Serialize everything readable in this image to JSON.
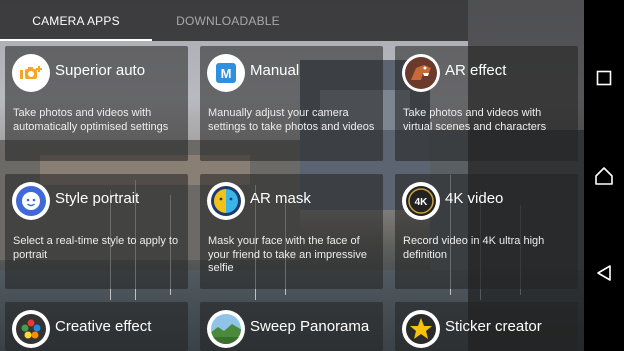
{
  "tabs": [
    {
      "label": "CAMERA APPS",
      "active": true
    },
    {
      "label": "DOWNLOADABLE",
      "active": false
    }
  ],
  "apps": [
    {
      "name": "Superior auto",
      "description": "Take photos and videos with automatically optimised settings",
      "icon": "superior-auto-icon"
    },
    {
      "name": "Manual",
      "description": "Manually adjust your camera settings to take photos and videos",
      "icon": "manual-m-icon"
    },
    {
      "name": "AR effect",
      "description": "Take photos and videos with virtual scenes and characters",
      "icon": "dinosaur-icon"
    },
    {
      "name": "Style portrait",
      "description": "Select a real-time style to apply to portrait",
      "icon": "style-portrait-face-icon"
    },
    {
      "name": "AR mask",
      "description": "Mask your face with the face of your friend to take an impressive selfie",
      "icon": "ar-mask-face-icon"
    },
    {
      "name": "4K video",
      "description": "Record video in 4K ultra high definition",
      "icon": "4k-video-icon"
    },
    {
      "name": "Creative effect",
      "description": "",
      "icon": "palette-icon"
    },
    {
      "name": "Sweep Panorama",
      "description": "",
      "icon": "panorama-icon"
    },
    {
      "name": "Sticker creator",
      "description": "",
      "icon": "star-sticker-icon"
    }
  ],
  "navbar": {
    "buttons": [
      "recents-square-icon",
      "home-house-icon",
      "back-triangle-icon"
    ]
  },
  "colors": {
    "accent_blue": "#2f6fd8",
    "tab_bg": "#1e1e1e"
  }
}
